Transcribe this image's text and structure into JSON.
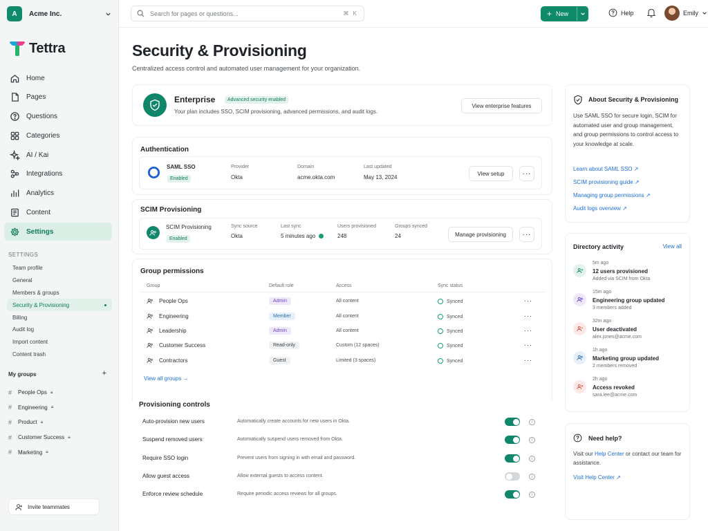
{
  "workspace": {
    "initial": "A",
    "name": "Acme Inc."
  },
  "brand": {
    "name": "Tettra",
    "accent": "#0f8a6a"
  },
  "nav": [
    {
      "label": "Home",
      "icon": "home-icon"
    },
    {
      "label": "Pages",
      "icon": "pages-icon"
    },
    {
      "label": "Questions",
      "icon": "question-icon"
    },
    {
      "label": "Categories",
      "icon": "categories-icon"
    },
    {
      "label": "AI / Kai",
      "icon": "sparkle-icon"
    },
    {
      "label": "Integrations",
      "icon": "integrations-icon"
    },
    {
      "label": "Analytics",
      "icon": "analytics-icon"
    },
    {
      "label": "Content",
      "icon": "content-icon"
    },
    {
      "label": "Settings",
      "icon": "gear-icon",
      "active": true
    }
  ],
  "settings_section": {
    "label": "SETTINGS",
    "items": [
      "Team profile",
      "General",
      "Members & groups",
      "Security & Provisioning",
      "Billing",
      "Audit log",
      "Import content",
      "Content trash"
    ],
    "active_index": 3
  },
  "my_groups": {
    "label": "My groups",
    "add": "+",
    "items": [
      "People Ops",
      "Engineering",
      "Product",
      "Customer Success",
      "Marketing"
    ]
  },
  "invite": {
    "label": "Invite teammates"
  },
  "topbar": {
    "search_placeholder": "Search for pages or questions...",
    "shortcut": "⌘ K",
    "new_label": "New",
    "help_label": "Help",
    "user_name": "Emily"
  },
  "page": {
    "title": "Security & Provisioning",
    "subtitle": "Centralized access control and automated user management for your organization."
  },
  "enterprise": {
    "title": "Enterprise",
    "badge": "Advanced security enabled",
    "description": "Your plan includes SSO, SCIM provisioning, advanced permissions, and audit logs.",
    "button": "View enterprise features"
  },
  "authentication": {
    "title": "Authentication",
    "name": "SAML SSO",
    "status": "Enabled",
    "provider_label": "Provider",
    "provider": "Okta",
    "domain_label": "Domain",
    "domain": "acme.okta.com",
    "updated_label": "Last updated",
    "updated": "May 13, 2024",
    "button": "View setup",
    "more": "···"
  },
  "scim": {
    "title": "SCIM Provisioning",
    "name": "SCIM Provisioning",
    "status": "Enabled",
    "source_label": "Sync source",
    "source": "Okta",
    "last_label": "Last sync",
    "last": "5 minutes ago",
    "users_label": "Users provisioned",
    "users": "248",
    "groups_label": "Groups synced",
    "groups": "24",
    "button": "Manage provisioning",
    "more": "···"
  },
  "group_permissions": {
    "title": "Group permissions",
    "columns": [
      "Group",
      "Default role",
      "Access",
      "Sync status"
    ],
    "rows": [
      {
        "group": "People Ops",
        "role": "Admin",
        "role_style": "admin",
        "access": "All content",
        "sync": "Synced"
      },
      {
        "group": "Engineering",
        "role": "Member",
        "role_style": "member",
        "access": "All content",
        "sync": "Synced"
      },
      {
        "group": "Leadership",
        "role": "Admin",
        "role_style": "admin",
        "access": "All content",
        "sync": "Synced"
      },
      {
        "group": "Customer Success",
        "role": "Read-only",
        "role_style": "plain",
        "access": "Custom (12 spaces)",
        "sync": "Synced"
      },
      {
        "group": "Contractors",
        "role": "Guest",
        "role_style": "plain",
        "access": "Limited (3 spaces)",
        "sync": "Synced"
      }
    ],
    "row_more": "···",
    "view_all": "View all groups →"
  },
  "provisioning_controls": {
    "title": "Provisioning controls",
    "items": [
      {
        "label": "Auto-provision new users",
        "desc": "Automatically create accounts for new users in Okta.",
        "on": true
      },
      {
        "label": "Suspend removed users",
        "desc": "Automatically suspend users removed from Okta.",
        "on": true
      },
      {
        "label": "Require SSO login",
        "desc": "Prevent users from signing in with email and password.",
        "on": true
      },
      {
        "label": "Allow guest access",
        "desc": "Allow external guests to access content.",
        "on": false
      },
      {
        "label": "Enforce review schedule",
        "desc": "Require periodic access reviews for all groups.",
        "on": true
      }
    ]
  },
  "about": {
    "title": "About Security & Provisioning",
    "text": "Use SAML SSO for secure login, SCIM for automated user and group management, and group permissions to control access to your knowledge at scale.",
    "links": [
      "Learn about SAML SSO ↗",
      "SCIM provisioning guide ↗",
      "Managing group permissions ↗",
      "Audit logs overview ↗"
    ]
  },
  "activity": {
    "title": "Directory activity",
    "view_all": "View all",
    "items": [
      {
        "time": "5m ago",
        "title": "12 users provisioned",
        "sub": "Added via SCIM from Okta",
        "color": "#e3f3ec",
        "fg": "#10876a"
      },
      {
        "time": "15m ago",
        "title": "Engineering group updated",
        "sub": "3 members added",
        "color": "#efe8fb",
        "fg": "#6b45c6"
      },
      {
        "time": "32m ago",
        "title": "User deactivated",
        "sub": "alex.jones@acme.com",
        "color": "#fde8e6",
        "fg": "#d24b3e"
      },
      {
        "time": "1h ago",
        "title": "Marketing group updated",
        "sub": "2 members removed",
        "color": "#e5f0fb",
        "fg": "#2b6cb0"
      },
      {
        "time": "2h ago",
        "title": "Access revoked",
        "sub": "sara.lee@acme.com",
        "color": "#fde8e6",
        "fg": "#d24b3e"
      }
    ]
  },
  "need_help": {
    "title": "Need help?",
    "text_before": "Visit our ",
    "text_link": "Help Center",
    "text_after": " or contact our team for assistance.",
    "link": "Visit Help Center ↗"
  }
}
